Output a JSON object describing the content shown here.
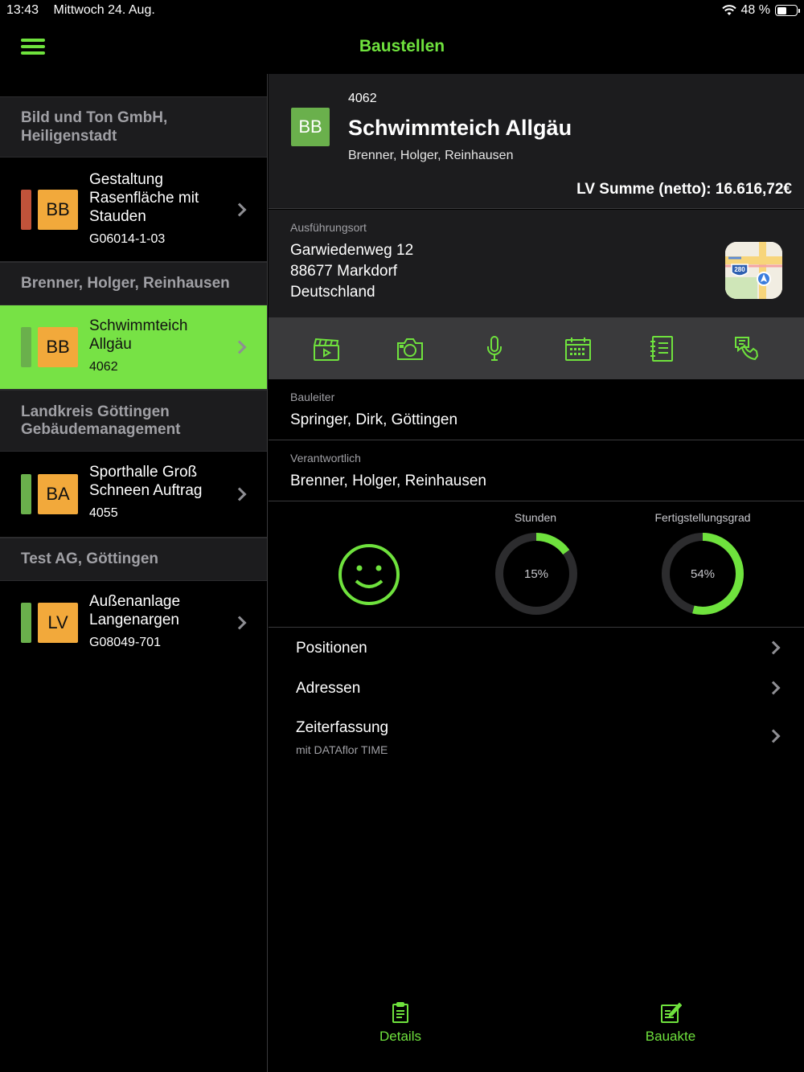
{
  "status": {
    "time": "13:43",
    "date": "Mittwoch 24. Aug.",
    "battery": "48 %",
    "battery_level": 0.48
  },
  "nav": {
    "title": "Baustellen",
    "menu_icon": "hamburger-icon",
    "accent": "#6fe23d"
  },
  "sidebar": {
    "groups": [
      {
        "header": "Bild und Ton GmbH,\nHeiligenstadt",
        "items": [
          {
            "title": "Gestaltung Rasenfläche mit Stauden",
            "code": "G06014-1-03",
            "badge": "BB",
            "bar_color": "#c0533a",
            "selected": false
          }
        ]
      },
      {
        "header": "Brenner, Holger, Reinhausen",
        "items": [
          {
            "title": "Schwimmteich Allgäu",
            "code": "4062",
            "badge": "BB",
            "bar_color": "#6ab04c",
            "selected": true
          }
        ]
      },
      {
        "header": "Landkreis Göttingen Gebäudemanagement",
        "items": [
          {
            "title": "Sporthalle Groß Schneen Auftrag",
            "code": "4055",
            "badge": "BA",
            "bar_color": "#6ab04c",
            "selected": false
          }
        ]
      },
      {
        "header": "Test AG, Göttingen",
        "items": [
          {
            "title": "Außenanlage Langenargen",
            "code": "G08049-701",
            "badge": "LV",
            "bar_color": "#6ab04c",
            "selected": false
          }
        ]
      }
    ]
  },
  "detail": {
    "badge": "BB",
    "number": "4062",
    "name": "Schwimmteich Allgäu",
    "owner": "Brenner, Holger, Reinhausen",
    "lv_sum": "LV Summe (netto):  16.616,72€",
    "location_label": "Ausführungsort",
    "street": "Garwiedenweg 12",
    "city": "88677  Markdorf",
    "country": "Deutschland",
    "maps_icon": "apple-maps-icon",
    "toolbar_icons": [
      "clapperboard-icon",
      "camera-icon",
      "microphone-icon",
      "calendar-icon",
      "notes-icon",
      "phone-icon"
    ],
    "bauleiter_label": "Bauleiter",
    "bauleiter": "Springer, Dirk, Göttingen",
    "verantwortlich_label": "Verantwortlich",
    "verantwortlich": "Brenner, Holger, Reinhausen",
    "mood_icon": "smiley-icon",
    "stunden_label": "Stunden",
    "stunden_text": "15%",
    "stunden_value": 0.15,
    "fertig_label": "Fertigstellungsgrad",
    "fertig_text": "54%",
    "fertig_value": 0.54,
    "menu": [
      {
        "label": "Positionen",
        "sub": ""
      },
      {
        "label": "Adressen",
        "sub": ""
      },
      {
        "label": "Zeiterfassung",
        "sub": "mit DATAflor TIME"
      }
    ]
  },
  "tabs": [
    {
      "label": "Details",
      "icon": "clipboard-icon"
    },
    {
      "label": "Bauakte",
      "icon": "edit-document-icon"
    }
  ]
}
